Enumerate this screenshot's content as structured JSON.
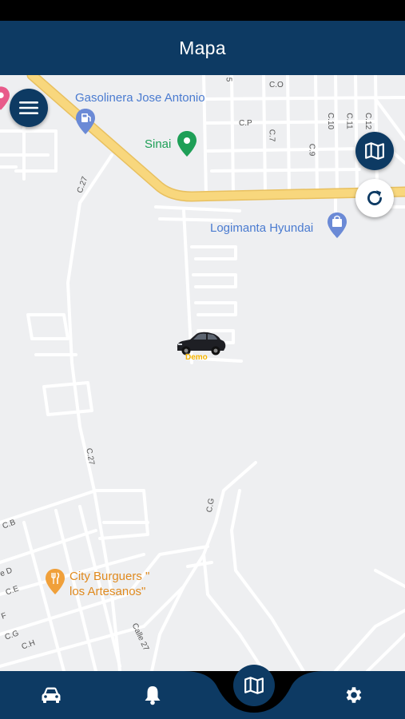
{
  "header": {
    "title": "Mapa"
  },
  "map": {
    "pois": {
      "gas_station": "Gasolinera Jose Antonio",
      "sinai": "Sinai",
      "dealer": "Logimanta Hyundai",
      "restaurant_line1": "City Burguers \"",
      "restaurant_line2": "los Artesanos\""
    },
    "streets": {
      "c_o": "C.O",
      "c_p": "C.P",
      "c_5": "5",
      "c_7": "C.7",
      "c_9": "C.9",
      "c_10": "C.10",
      "c_11": "C.11",
      "c_12": "C.12",
      "c_27_top": "C.27",
      "c_27_mid": "C.27",
      "c_g_right": "C.G",
      "c_b": "C.B",
      "c_d": "e D",
      "c_e": "C.E",
      "c_f": "F",
      "c_g_left": "C.G",
      "c_h": "C.H",
      "calle_27": "Calle 27"
    },
    "vehicle": {
      "label": "Demo"
    }
  },
  "colors": {
    "primary": "#0d3a63",
    "highway": "#f6d57b",
    "road": "#ffffff",
    "map_bg": "#eeeff1",
    "poi_blue": "#4a7bd0",
    "poi_green": "#1e9f57",
    "poi_orange": "#e08a1e",
    "vehicle_label": "#f5b400"
  },
  "icons": {
    "menu": "menu-icon",
    "map_layers": "map-icon",
    "refresh": "refresh-icon",
    "car_tab": "car-icon",
    "notifications_tab": "bell-icon",
    "map_tab": "map-icon",
    "settings_tab": "gear-icon"
  }
}
